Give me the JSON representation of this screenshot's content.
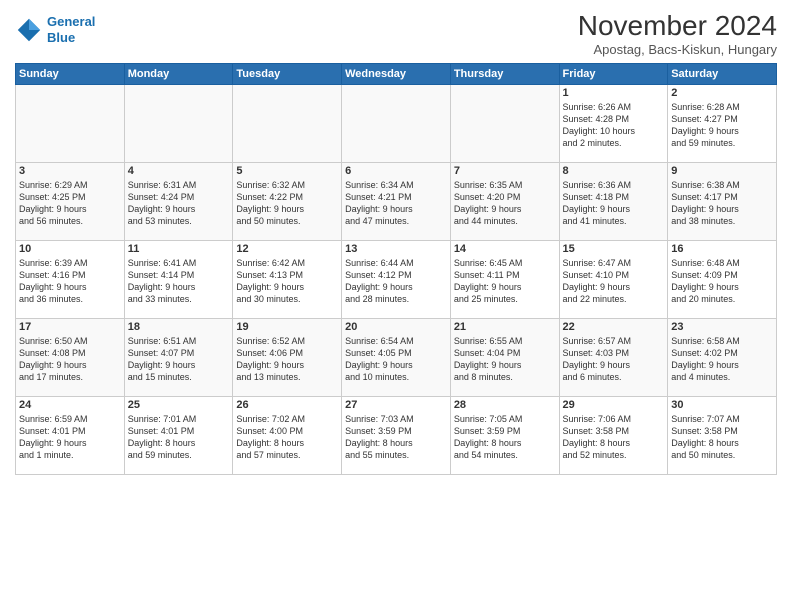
{
  "header": {
    "logo_line1": "General",
    "logo_line2": "Blue",
    "month_title": "November 2024",
    "subtitle": "Apostag, Bacs-Kiskun, Hungary"
  },
  "weekdays": [
    "Sunday",
    "Monday",
    "Tuesday",
    "Wednesday",
    "Thursday",
    "Friday",
    "Saturday"
  ],
  "weeks": [
    [
      {
        "day": "",
        "info": ""
      },
      {
        "day": "",
        "info": ""
      },
      {
        "day": "",
        "info": ""
      },
      {
        "day": "",
        "info": ""
      },
      {
        "day": "",
        "info": ""
      },
      {
        "day": "1",
        "info": "Sunrise: 6:26 AM\nSunset: 4:28 PM\nDaylight: 10 hours\nand 2 minutes."
      },
      {
        "day": "2",
        "info": "Sunrise: 6:28 AM\nSunset: 4:27 PM\nDaylight: 9 hours\nand 59 minutes."
      }
    ],
    [
      {
        "day": "3",
        "info": "Sunrise: 6:29 AM\nSunset: 4:25 PM\nDaylight: 9 hours\nand 56 minutes."
      },
      {
        "day": "4",
        "info": "Sunrise: 6:31 AM\nSunset: 4:24 PM\nDaylight: 9 hours\nand 53 minutes."
      },
      {
        "day": "5",
        "info": "Sunrise: 6:32 AM\nSunset: 4:22 PM\nDaylight: 9 hours\nand 50 minutes."
      },
      {
        "day": "6",
        "info": "Sunrise: 6:34 AM\nSunset: 4:21 PM\nDaylight: 9 hours\nand 47 minutes."
      },
      {
        "day": "7",
        "info": "Sunrise: 6:35 AM\nSunset: 4:20 PM\nDaylight: 9 hours\nand 44 minutes."
      },
      {
        "day": "8",
        "info": "Sunrise: 6:36 AM\nSunset: 4:18 PM\nDaylight: 9 hours\nand 41 minutes."
      },
      {
        "day": "9",
        "info": "Sunrise: 6:38 AM\nSunset: 4:17 PM\nDaylight: 9 hours\nand 38 minutes."
      }
    ],
    [
      {
        "day": "10",
        "info": "Sunrise: 6:39 AM\nSunset: 4:16 PM\nDaylight: 9 hours\nand 36 minutes."
      },
      {
        "day": "11",
        "info": "Sunrise: 6:41 AM\nSunset: 4:14 PM\nDaylight: 9 hours\nand 33 minutes."
      },
      {
        "day": "12",
        "info": "Sunrise: 6:42 AM\nSunset: 4:13 PM\nDaylight: 9 hours\nand 30 minutes."
      },
      {
        "day": "13",
        "info": "Sunrise: 6:44 AM\nSunset: 4:12 PM\nDaylight: 9 hours\nand 28 minutes."
      },
      {
        "day": "14",
        "info": "Sunrise: 6:45 AM\nSunset: 4:11 PM\nDaylight: 9 hours\nand 25 minutes."
      },
      {
        "day": "15",
        "info": "Sunrise: 6:47 AM\nSunset: 4:10 PM\nDaylight: 9 hours\nand 22 minutes."
      },
      {
        "day": "16",
        "info": "Sunrise: 6:48 AM\nSunset: 4:09 PM\nDaylight: 9 hours\nand 20 minutes."
      }
    ],
    [
      {
        "day": "17",
        "info": "Sunrise: 6:50 AM\nSunset: 4:08 PM\nDaylight: 9 hours\nand 17 minutes."
      },
      {
        "day": "18",
        "info": "Sunrise: 6:51 AM\nSunset: 4:07 PM\nDaylight: 9 hours\nand 15 minutes."
      },
      {
        "day": "19",
        "info": "Sunrise: 6:52 AM\nSunset: 4:06 PM\nDaylight: 9 hours\nand 13 minutes."
      },
      {
        "day": "20",
        "info": "Sunrise: 6:54 AM\nSunset: 4:05 PM\nDaylight: 9 hours\nand 10 minutes."
      },
      {
        "day": "21",
        "info": "Sunrise: 6:55 AM\nSunset: 4:04 PM\nDaylight: 9 hours\nand 8 minutes."
      },
      {
        "day": "22",
        "info": "Sunrise: 6:57 AM\nSunset: 4:03 PM\nDaylight: 9 hours\nand 6 minutes."
      },
      {
        "day": "23",
        "info": "Sunrise: 6:58 AM\nSunset: 4:02 PM\nDaylight: 9 hours\nand 4 minutes."
      }
    ],
    [
      {
        "day": "24",
        "info": "Sunrise: 6:59 AM\nSunset: 4:01 PM\nDaylight: 9 hours\nand 1 minute."
      },
      {
        "day": "25",
        "info": "Sunrise: 7:01 AM\nSunset: 4:01 PM\nDaylight: 8 hours\nand 59 minutes."
      },
      {
        "day": "26",
        "info": "Sunrise: 7:02 AM\nSunset: 4:00 PM\nDaylight: 8 hours\nand 57 minutes."
      },
      {
        "day": "27",
        "info": "Sunrise: 7:03 AM\nSunset: 3:59 PM\nDaylight: 8 hours\nand 55 minutes."
      },
      {
        "day": "28",
        "info": "Sunrise: 7:05 AM\nSunset: 3:59 PM\nDaylight: 8 hours\nand 54 minutes."
      },
      {
        "day": "29",
        "info": "Sunrise: 7:06 AM\nSunset: 3:58 PM\nDaylight: 8 hours\nand 52 minutes."
      },
      {
        "day": "30",
        "info": "Sunrise: 7:07 AM\nSunset: 3:58 PM\nDaylight: 8 hours\nand 50 minutes."
      }
    ]
  ]
}
